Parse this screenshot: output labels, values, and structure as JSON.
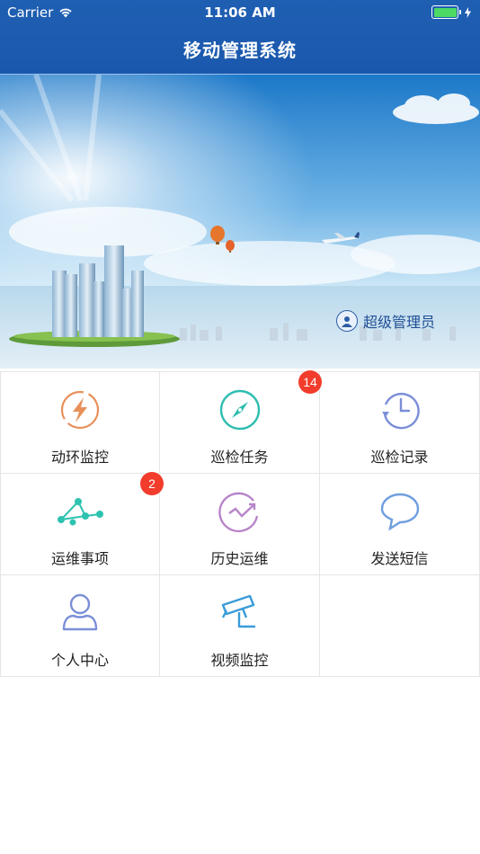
{
  "status_bar": {
    "carrier": "Carrier",
    "time": "11:06 AM"
  },
  "header": {
    "title": "移动管理系统"
  },
  "banner": {
    "user_label": "超级管理员"
  },
  "menu": {
    "items": [
      {
        "label": "动环监控",
        "icon": "lightning-icon",
        "color": "#e8905a",
        "badge": ""
      },
      {
        "label": "巡检任务",
        "icon": "compass-icon",
        "color": "#2dbdb0",
        "badge": "14"
      },
      {
        "label": "巡检记录",
        "icon": "history-clock-icon",
        "color": "#7b8fd8",
        "badge": ""
      },
      {
        "label": "运维事项",
        "icon": "network-nodes-icon",
        "color": "#2ec3b0",
        "badge": "2"
      },
      {
        "label": "历史运维",
        "icon": "trend-chart-icon",
        "color": "#b784c9",
        "badge": ""
      },
      {
        "label": "发送短信",
        "icon": "chat-bubble-icon",
        "color": "#6f9fe0",
        "badge": ""
      },
      {
        "label": "个人中心",
        "icon": "user-icon",
        "color": "#7b8fd8",
        "badge": ""
      },
      {
        "label": "视频监控",
        "icon": "camera-icon",
        "color": "#3a9bd8",
        "badge": ""
      }
    ]
  }
}
